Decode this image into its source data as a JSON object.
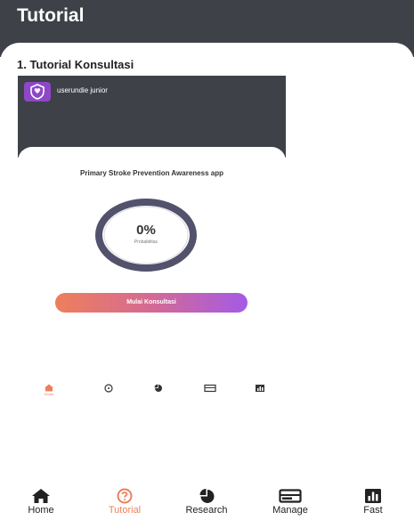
{
  "header": {
    "title": "Tutorial"
  },
  "section": {
    "title": "1. Tutorial Konsultasi"
  },
  "tutorial_screenshot": {
    "username": "userundie junior",
    "app_title": "Primary Stroke Prevention Awareness app",
    "progress": {
      "percent_text": "0%",
      "label": "Probabilitas",
      "value": 0
    },
    "cta_label": "Mulai Konsultasi",
    "nav": {
      "active_label": "Home"
    }
  },
  "bottom_nav": {
    "items": [
      {
        "label": "Home",
        "icon": "home-icon"
      },
      {
        "label": "Tutorial",
        "icon": "help-circle-icon",
        "active": true
      },
      {
        "label": "Research",
        "icon": "pie-chart-icon"
      },
      {
        "label": "Manage",
        "icon": "table-icon"
      },
      {
        "label": "Fast",
        "icon": "bar-chart-icon"
      }
    ]
  },
  "colors": {
    "header_bg": "#3e4148",
    "accent": "#ee7f5b",
    "gradient_end": "#a45ae6",
    "ring": "#53526d",
    "logo": "#8e47c7"
  }
}
